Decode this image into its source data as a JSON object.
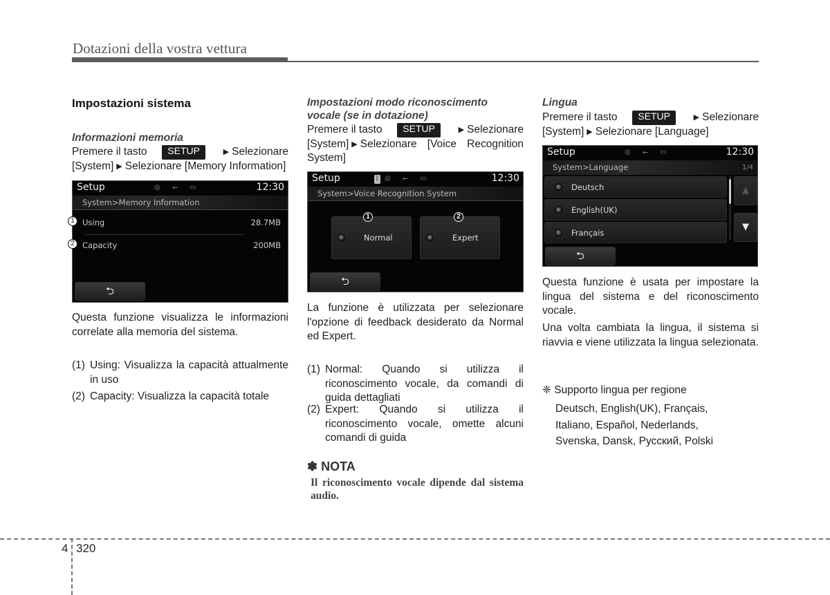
{
  "header": {
    "title": "Dotazioni della vostra vettura"
  },
  "footer": {
    "chapter": "4",
    "page": "320"
  },
  "column1": {
    "section_title": "Impostazioni sistema",
    "subtitle": "Informazioni memoria",
    "instr_prefix": "Premere il tasto",
    "setup_key": "SETUP",
    "instr_line1_suffix": "Selezionare",
    "instr_line2_a": "[System]",
    "instr_line2_b": "Selezionare [Memory Information]",
    "screen": {
      "title": "Setup",
      "time": "12:30",
      "status_icons": "◎ ⭠ ▭",
      "breadcrumb": "System>Memory Information",
      "rows": [
        {
          "callout": "1",
          "label": "Using",
          "value": "28.7MB"
        },
        {
          "callout": "2",
          "label": "Capacity",
          "value": "200MB"
        }
      ],
      "back_symbol": "⮌"
    },
    "description": "Questa funzione visualizza le informazioni correlate alla memoria del sistema.",
    "list": [
      {
        "num": "(1)",
        "text": "Using: Visualizza la capacità attualmente in uso"
      },
      {
        "num": "(2)",
        "text": "Capacity: Visualizza la capacità totale"
      }
    ]
  },
  "column2": {
    "subtitle": "Impostazioni modo riconoscimento vocale (se in dotazione)",
    "instr_prefix": "Premere il tasto",
    "setup_key": "SETUP",
    "instr_line1_suffix": "Selezionare",
    "instr_line2_a": "[System]",
    "instr_line2_b": "Selezionare [Voice Recognition System]",
    "screen": {
      "title": "Setup",
      "time": "12:30",
      "bt_icon": "ᛒ",
      "status_icons": "◎ ⭠ ▭",
      "breadcrumb": "System>Voice Recognition System",
      "options": [
        {
          "callout": "1",
          "label": "Normal"
        },
        {
          "callout": "2",
          "label": "Expert"
        }
      ],
      "back_symbol": "⮌"
    },
    "description": "La funzione è utilizzata per selezionare l'opzione di feedback desiderato da Normal ed Expert.",
    "list": [
      {
        "num": "(1)",
        "text": "Normal: Quando si utilizza il riconoscimento vocale, da comandi di guida dettagliati"
      },
      {
        "num": "(2)",
        "text": "Expert: Quando si utilizza il riconoscimento vocale, omette alcuni comandi di guida"
      }
    ],
    "nota_title": "✽ NOTA",
    "nota_body": "Il riconoscimento vocale dipende dal sistema audio."
  },
  "column3": {
    "subtitle": "Lingua",
    "instr_prefix": "Premere il tasto",
    "setup_key": "SETUP",
    "instr_line1_suffix": "Selezionare",
    "instr_line2_a": "[System]",
    "instr_line2_b": "Selezionare [Language]",
    "screen": {
      "title": "Setup",
      "time": "12:30",
      "status_icons": "◎ ⭠ ▭",
      "breadcrumb": "System>Language",
      "page_indicator": "1/4",
      "languages": [
        "Deutsch",
        "English(UK)",
        "Français"
      ],
      "scroll_up": "▲",
      "scroll_down": "▼",
      "back_symbol": "⮌"
    },
    "description1": "Questa funzione è usata per impostare la lingua del sistema e del riconoscimento vocale.",
    "description2": "Una volta cambiata la lingua, il sistema si riavvia e viene utilizzata la lingua selezionata.",
    "region_note": "❈ Supporto lingua per regione",
    "region_lines": [
      "Deutsch, English(UK), Français,",
      "Italiano, Español, Nederlands,",
      "Svenska, Dansk, Русский, Polski"
    ]
  }
}
